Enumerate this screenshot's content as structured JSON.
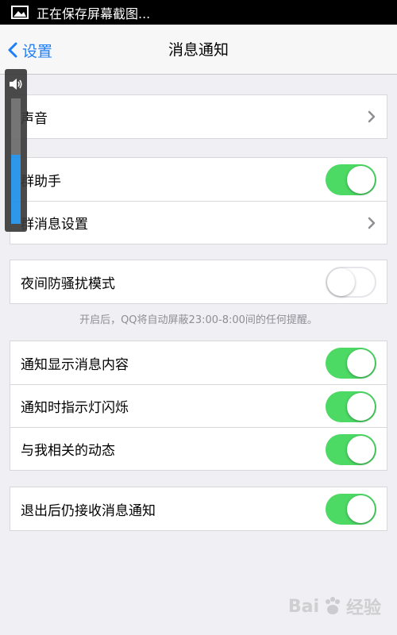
{
  "status_bar": {
    "notification_text": "正在保存屏幕截图..."
  },
  "nav": {
    "back_label": "设置",
    "title": "消息通知"
  },
  "groups": [
    {
      "rows": [
        {
          "label": "声音",
          "control": "chevron"
        }
      ]
    },
    {
      "rows": [
        {
          "label": "群助手",
          "control": "toggle",
          "state": true
        },
        {
          "label": "群消息设置",
          "control": "chevron"
        }
      ]
    },
    {
      "rows": [
        {
          "label": "夜间防骚扰模式",
          "control": "toggle",
          "state": false
        }
      ]
    },
    {
      "rows": [
        {
          "label": "通知显示消息内容",
          "control": "toggle",
          "state": true
        },
        {
          "label": "通知时指示灯闪烁",
          "control": "toggle",
          "state": true
        },
        {
          "label": "与我相关的动态",
          "control": "toggle",
          "state": true
        }
      ]
    },
    {
      "rows": [
        {
          "label": "退出后仍接收消息通知",
          "control": "toggle",
          "state": true
        }
      ]
    }
  ],
  "night_mode_note": "开启后，QQ将自动屏蔽23:00-8:00间的任何提醒。",
  "volume_overlay": {
    "icon": "speaker-icon",
    "level": 0.55
  },
  "watermark": {
    "text_left": "Bai",
    "text_right": "经验"
  },
  "colors": {
    "accent": "#1d7ef5",
    "toggle_on": "#4cd964",
    "background": "#efeff4"
  }
}
